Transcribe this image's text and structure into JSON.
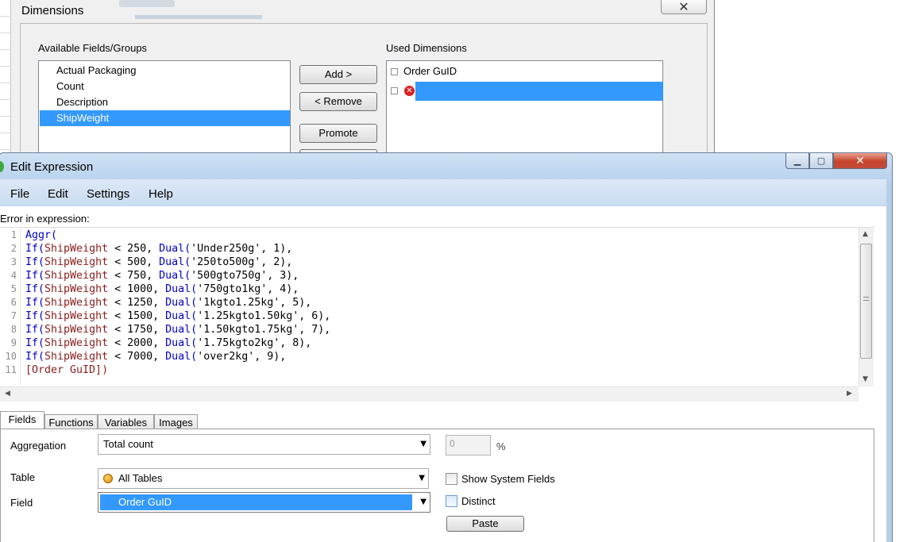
{
  "dimensions_dialog": {
    "title": "Dimensions",
    "close_glyph": "✕",
    "available_label": "Available Fields/Groups",
    "available_fields": [
      "Actual Packaging",
      "Count",
      "Description",
      "ShipWeight"
    ],
    "selected_available": "ShipWeight",
    "used_label": "Used Dimensions",
    "used_dimensions": [
      "Order GuID",
      ""
    ],
    "expand_glyph": "⊞",
    "error_glyph": "✕",
    "buttons": {
      "add": "Add >",
      "remove": "< Remove",
      "promote": "Promote"
    }
  },
  "edit_expression": {
    "title": "Edit Expression",
    "caption_buttons": {
      "minimize": "▁",
      "maximize": "▢",
      "close": "✕"
    },
    "menu": [
      "File",
      "Edit",
      "Settings",
      "Help"
    ],
    "error_label": "Error in expression:",
    "line_numbers": [
      "1",
      "2",
      "3",
      "4",
      "5",
      "6",
      "7",
      "8",
      "9",
      "10",
      "11"
    ],
    "code_lines": [
      "Aggr(",
      "If(ShipWeight < 250, Dual('Under250g', 1),",
      "If(ShipWeight < 500, Dual('250to500g', 2),",
      "If(ShipWeight < 750, Dual('500gto750g', 3),",
      "If(ShipWeight < 1000, Dual('750gto1kg', 4),",
      "If(ShipWeight < 1250, Dual('1kgto1.25kg', 5),",
      "If(ShipWeight < 1500, Dual('1.25kgto1.50kg', 6),",
      "If(ShipWeight < 1750, Dual('1.50kgto1.75kg', 7),",
      "If(ShipWeight < 2000, Dual('1.75kgto2kg', 8),",
      "If(ShipWeight < 7000, Dual('over2kg', 9),",
      "[Order GuID])"
    ],
    "tabs": [
      "Fields",
      "Functions",
      "Variables",
      "Images"
    ],
    "active_tab": "Fields",
    "fields_tab": {
      "aggregation_label": "Aggregation",
      "aggregation_value": "Total count",
      "percent_value": "0",
      "percent_sign": "%",
      "table_label": "Table",
      "table_value": "All Tables",
      "show_system_fields_label": "Show System Fields",
      "field_label": "Field",
      "field_value": "Order GuID",
      "distinct_label": "Distinct",
      "paste_button": "Paste"
    }
  },
  "colors": {
    "selection_blue": "#3399ff",
    "keyword_blue": "#0000cc",
    "field_red": "#8b1c1c",
    "title_bar": "#bcd4ee"
  }
}
